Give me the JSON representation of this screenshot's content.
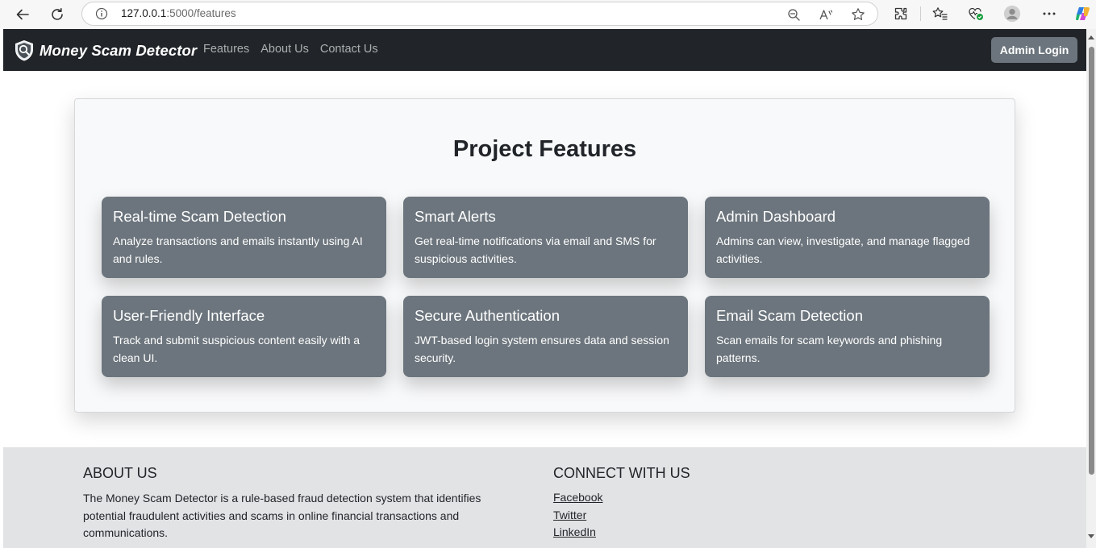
{
  "browser": {
    "url_host": "127.0.0.1",
    "url_rest": ":5000/features",
    "icons": {
      "back": "back-arrow-icon",
      "refresh": "refresh-icon",
      "info": "site-info-icon",
      "zoom": "zoom-out-icon",
      "read_aloud": "read-aloud-icon",
      "favorite": "favorite-star-icon",
      "extensions": "extensions-icon",
      "favorites": "favorites-list-icon",
      "health": "browser-essentials-icon",
      "profile": "profile-avatar-icon",
      "more": "more-options-icon",
      "copilot": "copilot-icon"
    }
  },
  "navbar": {
    "brand": "Money Scam Detector",
    "links": [
      "Features",
      "About Us",
      "Contact Us"
    ],
    "admin_button": "Admin Login"
  },
  "features": {
    "title": "Project Features",
    "cards": [
      {
        "title": "Real-time Scam Detection",
        "description": "Analyze transactions and emails instantly using AI and rules."
      },
      {
        "title": "Smart Alerts",
        "description": "Get real-time notifications via email and SMS for suspicious activities."
      },
      {
        "title": "Admin Dashboard",
        "description": "Admins can view, investigate, and manage flagged activities."
      },
      {
        "title": "User-Friendly Interface",
        "description": "Track and submit suspicious content easily with a clean UI."
      },
      {
        "title": "Secure Authentication",
        "description": "JWT-based login system ensures data and session security."
      },
      {
        "title": "Email Scam Detection",
        "description": "Scan emails for scam keywords and phishing patterns."
      }
    ]
  },
  "footer": {
    "about": {
      "heading": "ABOUT US",
      "text": "The Money Scam Detector is a rule-based fraud detection system that identifies potential fraudulent activities and scams in online financial transactions and communications."
    },
    "connect": {
      "heading": "CONNECT WITH US",
      "links": [
        "Facebook",
        "Twitter",
        "LinkedIn"
      ]
    }
  },
  "colors": {
    "navbar_bg": "#212529",
    "card_bg": "#6c757d",
    "panel_bg": "#f8f9fa",
    "footer_bg": "#e2e3e5"
  }
}
